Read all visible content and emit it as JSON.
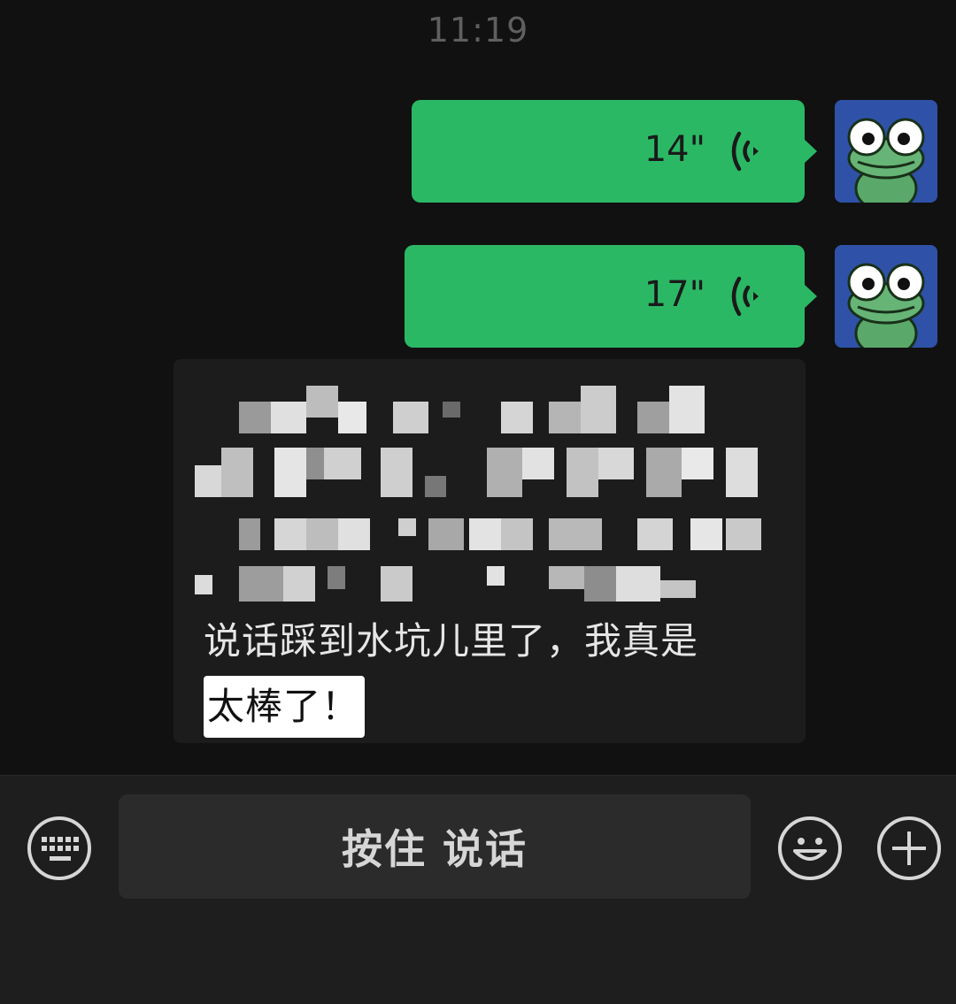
{
  "status_bar": {
    "time": "11:19"
  },
  "messages": [
    {
      "type": "voice",
      "sender": "me",
      "duration": "14\"",
      "icon": "voice-wave-icon"
    },
    {
      "type": "voice",
      "sender": "me",
      "duration": "17\"",
      "icon": "voice-wave-icon"
    }
  ],
  "transcript": {
    "visible_text_plain": "说话踩到水坑儿里了，我真是",
    "visible_text_highlight": "太棒了！"
  },
  "input_bar": {
    "hold_to_talk_label": "按住 说话",
    "keyboard_icon": "keyboard-icon",
    "emoji_icon": "smiley-icon",
    "plus_icon": "plus-icon"
  },
  "colors": {
    "background": "#111111",
    "voice_bubble": "#2bb865",
    "transcript_bg": "#1c1c1c",
    "input_bar_bg": "#1e1e1e",
    "highlight_bg": "#ffffff"
  }
}
